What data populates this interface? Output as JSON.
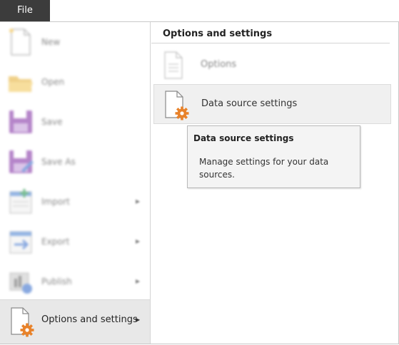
{
  "file_tab": {
    "label": "File"
  },
  "sidebar": {
    "items": [
      {
        "label": "New",
        "icon": "new-document-icon",
        "has_arrow": false
      },
      {
        "label": "Open",
        "icon": "folder-icon",
        "has_arrow": false
      },
      {
        "label": "Save",
        "icon": "save-icon",
        "has_arrow": false
      },
      {
        "label": "Save As",
        "icon": "save-as-icon",
        "has_arrow": false
      },
      {
        "label": "Import",
        "icon": "import-icon",
        "has_arrow": true
      },
      {
        "label": "Export",
        "icon": "export-icon",
        "has_arrow": true
      },
      {
        "label": "Publish",
        "icon": "publish-icon",
        "has_arrow": true
      },
      {
        "label": "Options and settings",
        "icon": "document-gear-icon",
        "has_arrow": true,
        "active": true
      }
    ],
    "arrow_glyph": "▶"
  },
  "panel": {
    "title": "Options and settings",
    "items": [
      {
        "label": "Options",
        "icon": "document-lines-icon"
      },
      {
        "label": "Data source settings",
        "icon": "document-gear-icon",
        "selected": true
      }
    ]
  },
  "tooltip": {
    "title": "Data source settings",
    "description": "Manage settings for your data sources."
  },
  "colors": {
    "file_tab_bg": "#3c3c3c",
    "gear_orange": "#e8822a",
    "save_purple": "#8e44ad"
  }
}
